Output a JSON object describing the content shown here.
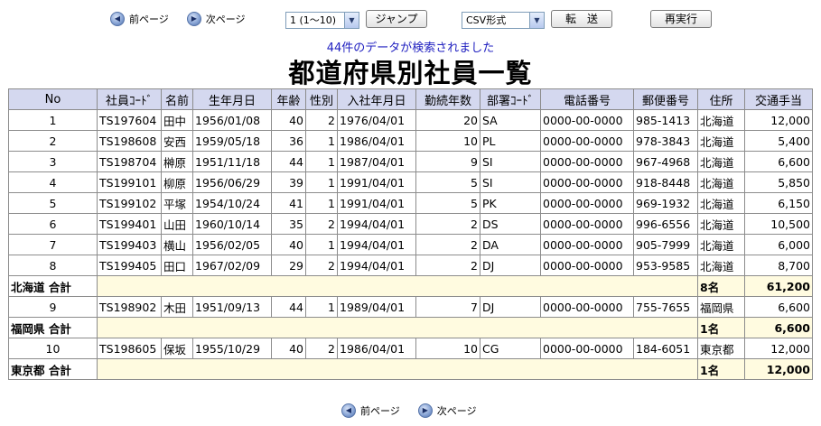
{
  "nav": {
    "prev": "前ページ",
    "next": "次ページ"
  },
  "toolbar": {
    "page_select": "1 (1〜10)",
    "jump": "ジャンプ",
    "format_select": "CSV形式",
    "transfer": "転　送",
    "rerun": "再実行"
  },
  "message": "44件のデータが検索されました",
  "title": "都道府県別社員一覧",
  "columns": [
    "No",
    "社員ｺｰﾄﾞ",
    "名前",
    "生年月日",
    "年齢",
    "性別",
    "入社年月日",
    "勤続年数",
    "部署ｺｰﾄﾞ",
    "電話番号",
    "郵便番号",
    "住所",
    "交通手当"
  ],
  "rows": [
    {
      "type": "row",
      "cells": [
        "1",
        "TS197604",
        "田中",
        "1956/01/08",
        "40",
        "2",
        "1976/04/01",
        "20",
        "SA",
        "0000-00-0000",
        "985-1413",
        "北海道",
        "12,000"
      ]
    },
    {
      "type": "row",
      "cells": [
        "2",
        "TS198608",
        "安西",
        "1959/05/18",
        "36",
        "1",
        "1986/04/01",
        "10",
        "PL",
        "0000-00-0000",
        "978-3843",
        "北海道",
        "5,400"
      ]
    },
    {
      "type": "row",
      "cells": [
        "3",
        "TS198704",
        "榊原",
        "1951/11/18",
        "44",
        "1",
        "1987/04/01",
        "9",
        "SI",
        "0000-00-0000",
        "967-4968",
        "北海道",
        "6,600"
      ]
    },
    {
      "type": "row",
      "cells": [
        "4",
        "TS199101",
        "柳原",
        "1956/06/29",
        "39",
        "1",
        "1991/04/01",
        "5",
        "SI",
        "0000-00-0000",
        "918-8448",
        "北海道",
        "5,850"
      ]
    },
    {
      "type": "row",
      "cells": [
        "5",
        "TS199102",
        "平塚",
        "1954/10/24",
        "41",
        "1",
        "1991/04/01",
        "5",
        "PK",
        "0000-00-0000",
        "969-1932",
        "北海道",
        "6,150"
      ]
    },
    {
      "type": "row",
      "cells": [
        "6",
        "TS199401",
        "山田",
        "1960/10/14",
        "35",
        "2",
        "1994/04/01",
        "2",
        "DS",
        "0000-00-0000",
        "996-6556",
        "北海道",
        "10,500"
      ]
    },
    {
      "type": "row",
      "cells": [
        "7",
        "TS199403",
        "横山",
        "1956/02/05",
        "40",
        "1",
        "1994/04/01",
        "2",
        "DA",
        "0000-00-0000",
        "905-7999",
        "北海道",
        "6,000"
      ]
    },
    {
      "type": "row",
      "cells": [
        "8",
        "TS199405",
        "田口",
        "1967/02/09",
        "29",
        "2",
        "1994/04/01",
        "2",
        "DJ",
        "0000-00-0000",
        "953-9585",
        "北海道",
        "8,700"
      ]
    },
    {
      "type": "subtotal",
      "label": "北海道 合計",
      "count": "8名",
      "total": "61,200"
    },
    {
      "type": "row",
      "cells": [
        "9",
        "TS198902",
        "木田",
        "1951/09/13",
        "44",
        "1",
        "1989/04/01",
        "7",
        "DJ",
        "0000-00-0000",
        "755-7655",
        "福岡県",
        "6,600"
      ]
    },
    {
      "type": "subtotal",
      "label": "福岡県 合計",
      "count": "1名",
      "total": "6,600"
    },
    {
      "type": "row",
      "cells": [
        "10",
        "TS198605",
        "保坂",
        "1955/10/29",
        "40",
        "2",
        "1986/04/01",
        "10",
        "CG",
        "0000-00-0000",
        "184-6051",
        "東京都",
        "12,000"
      ]
    },
    {
      "type": "subtotal",
      "label": "東京都 合計",
      "count": "1名",
      "total": "12,000"
    }
  ]
}
